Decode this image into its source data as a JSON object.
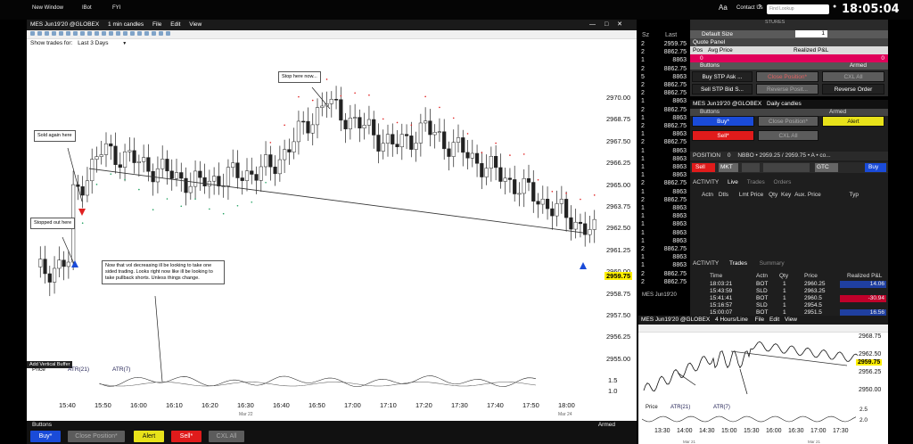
{
  "topbar": {
    "items": [
      "New Window",
      "IBot",
      "FYI"
    ],
    "font_icon": "Aa",
    "contact": "Contact Us",
    "help": "?",
    "search_placeholder": "Find Lookup",
    "clock": "18:05:04"
  },
  "main_window": {
    "title": "MES Jun19'20 @GLOBEX",
    "interval": "1 min candles",
    "menus": [
      "File",
      "Edit",
      "View"
    ],
    "show_trades_label": "Show trades for:",
    "show_trades_value": "Last 3 Days",
    "y_ticks": [
      "2970.00",
      "2968.75",
      "2967.50",
      "2966.25",
      "2965.00",
      "2963.75",
      "2962.50",
      "2961.25",
      "2960.00",
      "2958.75",
      "2957.50",
      "2956.25",
      "2955.00"
    ],
    "current_price": "2959.75",
    "x_ticks": [
      "15:40",
      "15:50",
      "16:00",
      "16:10",
      "16:20",
      "16:30",
      "16:40",
      "16:50",
      "17:00",
      "17:10",
      "17:20",
      "17:30",
      "17:40",
      "17:50",
      "18:00"
    ],
    "x_date_left": "Mar 22",
    "x_date_right": "Mar 24",
    "annotations": {
      "stop_here": "Stop here now...",
      "sold_again": "Sold again here",
      "stopped_out": "Stopped out here",
      "vol_note": "Now that vol decreasing ill be looking to take one sided trading. Looks right now like ill be looking to take pullback shorts. Unless things change."
    },
    "add_buffer": "Add Vertical Buffer",
    "atr_label": "Price",
    "atr_series": [
      "ATR(21)",
      "ATR(7)"
    ],
    "atr_ticks": [
      "1.5",
      "1.0"
    ],
    "buttons_header": "Buttons",
    "armed_label": "Armed",
    "buttons": [
      "Buy*",
      "Close Position*",
      "Alert",
      "Sell*",
      "CXL All"
    ]
  },
  "ladder": {
    "col_sz": "Sz",
    "col_last": "Last",
    "rows": [
      {
        "sz": "2",
        "px": "2959.75"
      },
      {
        "sz": "2",
        "px": "8862.75"
      },
      {
        "sz": "1",
        "px": "8863"
      },
      {
        "sz": "2",
        "px": "8862.75"
      },
      {
        "sz": "5",
        "px": "8863"
      },
      {
        "sz": "2",
        "px": "8862.75"
      },
      {
        "sz": "2",
        "px": "8862.75"
      },
      {
        "sz": "1",
        "px": "8863"
      },
      {
        "sz": "2",
        "px": "8862.75"
      },
      {
        "sz": "1",
        "px": "8863"
      },
      {
        "sz": "2",
        "px": "8862.75"
      },
      {
        "sz": "1",
        "px": "8863"
      },
      {
        "sz": "2",
        "px": "8862.75"
      },
      {
        "sz": "1",
        "px": "8863"
      },
      {
        "sz": "1",
        "px": "8863"
      },
      {
        "sz": "1",
        "px": "8863"
      },
      {
        "sz": "1",
        "px": "8863"
      },
      {
        "sz": "2",
        "px": "8862.75"
      },
      {
        "sz": "1",
        "px": "8863"
      },
      {
        "sz": "2",
        "px": "8862.75"
      },
      {
        "sz": "1",
        "px": "8863"
      },
      {
        "sz": "1",
        "px": "8863"
      },
      {
        "sz": "1",
        "px": "8863"
      },
      {
        "sz": "1",
        "px": "8863"
      },
      {
        "sz": "1",
        "px": "8863"
      },
      {
        "sz": "2",
        "px": "8862.75"
      },
      {
        "sz": "1",
        "px": "8863"
      },
      {
        "sz": "1",
        "px": "8863"
      },
      {
        "sz": "2",
        "px": "8862.75"
      },
      {
        "sz": "2",
        "px": "8862.75"
      }
    ],
    "footer": "MES Jun19'20"
  },
  "quote_panel": {
    "tab": "STURES",
    "title": "Quote Panel",
    "default_size_label": "Default Size",
    "default_size": "1",
    "pos_label": "Pos",
    "avg_label": "Avg Price",
    "pnl_label": "Realized P&L",
    "pos_value": "0",
    "pnl_value": "0",
    "buttons_header": "Buttons",
    "armed": "Armed",
    "buttons": [
      "Buy STP Ask ...",
      "Close Position*",
      "CXL All",
      "Sell STP Bid S...",
      "Reverse Posit...",
      "Reverse Order"
    ]
  },
  "daily_panel": {
    "title": "MES Jun19'20 @GLOBEX",
    "interval": "Daily candles",
    "buttons_header": "Buttons",
    "armed": "Armed",
    "buttons": [
      "Buy*",
      "Close Position*",
      "Alert",
      "Sell*",
      "CXL All"
    ],
    "position_label": "POSITION",
    "position_value": "0",
    "nbbo": "NBBO • 2959.25 / 2959.75 • A • co...",
    "order_side": "Sell",
    "order_type": "MKT",
    "tif": "GTC",
    "buy_side": "Buy",
    "activity_label": "ACTIVITY",
    "live_tab": "Live",
    "trades_tab": "Trades",
    "orders_tab": "Orders",
    "columns": [
      "Actn",
      "Dtls",
      "Lmt Price",
      "Qty",
      "Key",
      "Aux. Price",
      "Typ"
    ]
  },
  "trades_panel": {
    "activity_label": "ACTIVITY",
    "trades_tab": "Trades",
    "summary_tab": "Summary",
    "columns": [
      "Time",
      "Actn",
      "Qty",
      "Price",
      "Realized P&L"
    ],
    "rows": [
      {
        "time": "18:03:21",
        "actn": "BOT",
        "qty": "1",
        "price": "2960.25",
        "pnl": "14.06"
      },
      {
        "time": "15:43:59",
        "actn": "SLD",
        "qty": "1",
        "price": "2963.25",
        "pnl": ""
      },
      {
        "time": "15:41:41",
        "actn": "BOT",
        "qty": "1",
        "price": "2960.5",
        "pnl": "-30.94"
      },
      {
        "time": "15:16:57",
        "actn": "SLD",
        "qty": "1",
        "price": "2954.5",
        "pnl": ""
      },
      {
        "time": "15:00:07",
        "actn": "BOT",
        "qty": "1",
        "price": "2951.5",
        "pnl": "16.56"
      }
    ]
  },
  "small_chart": {
    "title": "MES Jun19'20 @GLOBEX",
    "interval": "4 Hours/Line",
    "menus": [
      "File",
      "Edit",
      "View"
    ],
    "y_ticks": [
      "2968.75",
      "2962.50",
      "2956.25",
      "2950.00"
    ],
    "current_price": "2959.75",
    "atr_label": "Price",
    "atr_series": [
      "ATR(21)",
      "ATR(7)"
    ],
    "atr_ticks": [
      "2.5",
      "2.0"
    ],
    "x_ticks": [
      "13:30",
      "14:00",
      "14:30",
      "15:00",
      "15:30",
      "16:00",
      "16:30",
      "17:00",
      "17:30"
    ],
    "dates": [
      "Mar 21",
      "Mar 21"
    ]
  },
  "colors": {
    "buy": "#1a4bd8",
    "sell": "#e01b1b",
    "alert": "#e8e21a",
    "current_price": "#ffef00",
    "gray_btn": "#5c5c5c"
  }
}
